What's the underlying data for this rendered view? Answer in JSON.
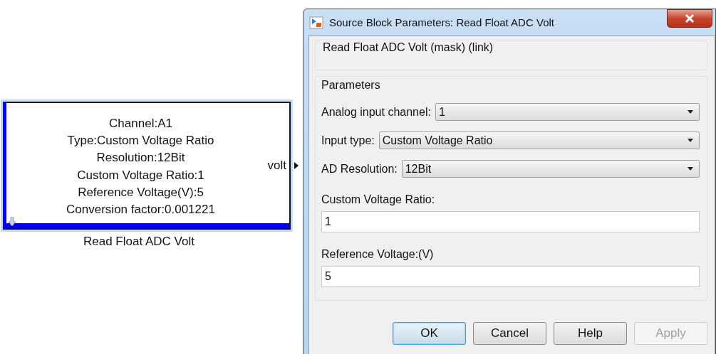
{
  "block": {
    "lines": [
      "Channel:A1",
      "Type:Custom Voltage Ratio",
      "Resolution:12Bit",
      "Custom Voltage Ratio:1",
      "Reference Voltage(V):5",
      "Conversion factor:0.001221"
    ],
    "port": "volt",
    "name": "Read Float ADC Volt"
  },
  "dialog": {
    "title": "Source Block Parameters: Read Float ADC Volt",
    "description_group": "Read Float ADC Volt (mask) (link)",
    "parameters_group": "Parameters",
    "parameters": [
      {
        "kind": "dropdown",
        "label": "Analog input channel:",
        "value": "1"
      },
      {
        "kind": "dropdown",
        "label": "Input type:",
        "value": "Custom Voltage Ratio"
      },
      {
        "kind": "dropdown",
        "label": "AD Resolution:",
        "value": "12Bit"
      },
      {
        "kind": "text",
        "label": "Custom Voltage Ratio:",
        "value": "1"
      },
      {
        "kind": "text",
        "label": "Reference Voltage:(V)",
        "value": "5"
      }
    ],
    "buttons": [
      {
        "label": "OK",
        "default": true,
        "disabled": false
      },
      {
        "label": "Cancel",
        "default": false,
        "disabled": false
      },
      {
        "label": "Help",
        "default": false,
        "disabled": false
      },
      {
        "label": "Apply",
        "default": false,
        "disabled": true
      }
    ]
  }
}
